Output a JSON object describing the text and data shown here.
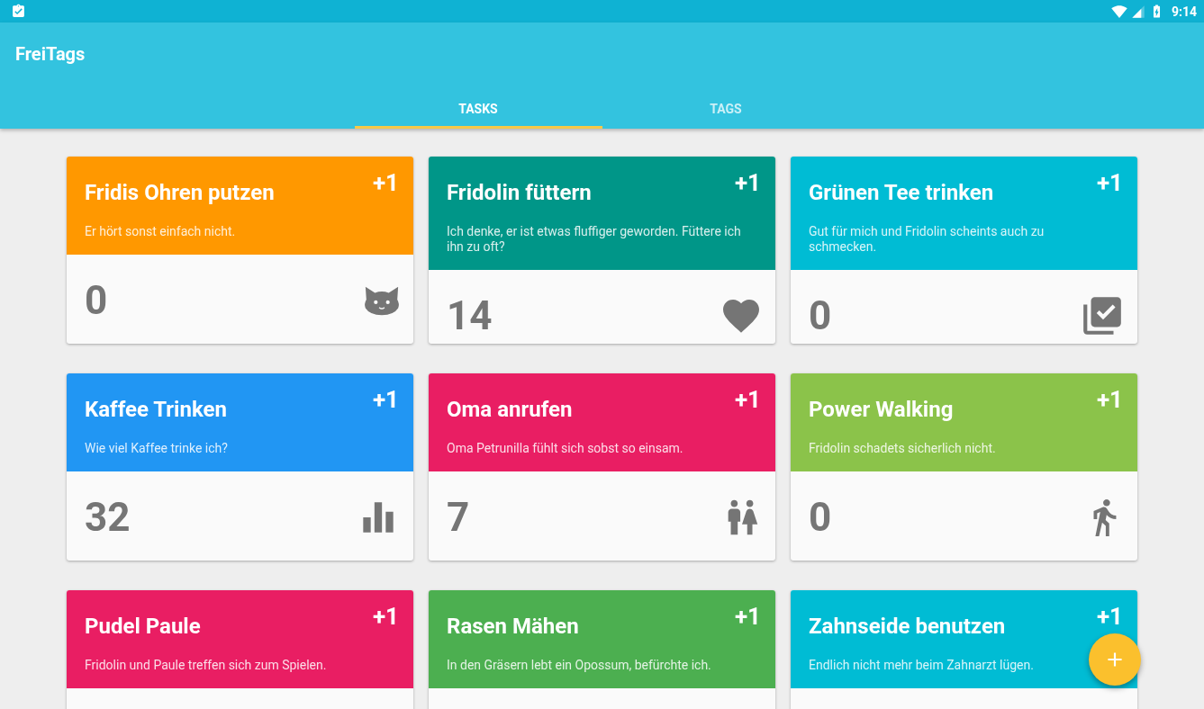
{
  "status_bar": {
    "time": "9:14"
  },
  "app_bar": {
    "title": "FreiTags"
  },
  "tabs": [
    {
      "label": "TASKS",
      "selected": true
    },
    {
      "label": "TAGS",
      "selected": false
    }
  ],
  "tasks": [
    {
      "title": "Fridis Ohren putzen",
      "description": "Er hört sonst einfach nicht.",
      "increment": "+1",
      "count": "0",
      "kind": "cat",
      "color": "#ff9800"
    },
    {
      "title": "Fridolin füttern",
      "description": "Ich denke, er ist etwas fluffiger geworden. Füttere ich ihn zu oft?",
      "increment": "+1",
      "count": "14",
      "kind": "heart",
      "color": "#009688"
    },
    {
      "title": "Grünen Tee trinken",
      "description": "Gut für mich und Fridolin scheints auch zu schmecken.",
      "increment": "+1",
      "count": "0",
      "kind": "checklist",
      "color": "#00bcd4"
    },
    {
      "title": "Kaffee Trinken",
      "description": "Wie viel Kaffee trinke ich?",
      "increment": "+1",
      "count": "32",
      "kind": "chart",
      "color": "#2196f3"
    },
    {
      "title": "Oma anrufen",
      "description": "Oma Petrunilla fühlt sich sobst so einsam.",
      "increment": "+1",
      "count": "7",
      "kind": "people",
      "color": "#e91e63"
    },
    {
      "title": "Power Walking",
      "description": "Fridolin schadets sicherlich nicht.",
      "increment": "+1",
      "count": "0",
      "kind": "walk",
      "color": "#8bc34a"
    },
    {
      "title": "Pudel Paule",
      "description": "Fridolin und Paule treffen sich zum Spielen.",
      "increment": "+1",
      "color": "#e91e63"
    },
    {
      "title": "Rasen Mähen",
      "description": "In den Gräsern lebt ein Opossum, befürchte ich.",
      "increment": "+1",
      "color": "#4caf50"
    },
    {
      "title": "Zahnseide benutzen",
      "description": "Endlich nicht mehr beim Zahnarzt lügen.",
      "increment": "+1",
      "color": "#00bcd4"
    }
  ]
}
